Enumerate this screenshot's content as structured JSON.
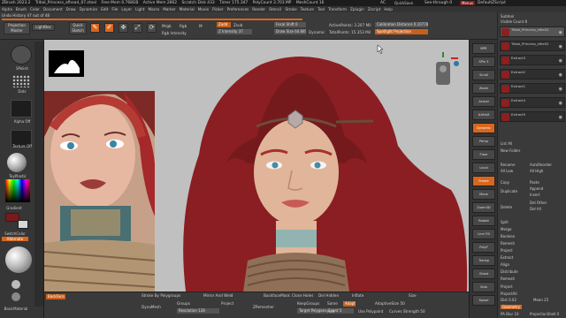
{
  "titlebar": {
    "app": "ZBrush 2023.2",
    "file": "Tribal_Princess_afhead_07.ztool",
    "free_mem": "Free Mem 0.768GB",
    "active_mem": "Active Mem 2862",
    "scratch": "Scratch Disk 433",
    "timer": "Timer 175.347",
    "polycount": "PolyCount 3.703 MP",
    "meshcount": "MeshCount 16",
    "ac": "AC",
    "quicksave": "QuickSave",
    "seethrough": "See-through 0",
    "menus": "Menus",
    "defaultzscript": "DefaultZScript"
  },
  "menubar": [
    "Alpha",
    "Brush",
    "Color",
    "Document",
    "Draw",
    "Dynamics",
    "Edit",
    "File",
    "Layer",
    "Light",
    "Macro",
    "Marker",
    "Material",
    "Movie",
    "Picker",
    "Preferences",
    "Render",
    "Stencil",
    "Stroke",
    "Texture",
    "Tool",
    "Transform",
    "Zplugin",
    "Zscript",
    "Help"
  ],
  "toolbar": {
    "history": "Undo History 47 out of 48",
    "projection_master": "Projection Master",
    "lightbox": "LightBox",
    "quick_sketch": "Quick Sketch",
    "edit": "Edit",
    "draw": "Draw",
    "move": "Move",
    "scale": "Scale",
    "rotate": "Rotate",
    "mrgb": "Mrgb",
    "rgb": "Rgb",
    "m": "M",
    "rgb_intensity": "Rgb Intensity",
    "zadd": "Zadd",
    "zsub": "Zsub",
    "z_intensity": "Z Intensity 37",
    "focal_shift": "Focal Shift 0",
    "draw_size": "Draw Size 64.68128",
    "dynamic": "Dynamic",
    "active_points": "ActivePoints: 3.207 Mil",
    "total_points": "TotalPoints: 15.353 Mil",
    "calibration": "Calibration Distance 0.10778",
    "spotlight": "Spotlight Projection"
  },
  "leftpanel": {
    "brush": "SPolish",
    "stroke": "Dots",
    "alpha": "Alpha Off",
    "texture": "Texture Off",
    "material": "ToyPlastic",
    "gradient": "Gradient",
    "switch_color": "SwitchColor",
    "alternate": "Alternate",
    "basic_material": "BasicMaterial"
  },
  "bottombar": {
    "backface": "BackFace",
    "polygroups": "Stroke By Polygroups",
    "mirror_weld": "Mirror And Weld",
    "backface_mask": "BackfaceMask",
    "close_holes": "Close Holes",
    "del_hidden": "Del Hidden",
    "inflate": "Inflate",
    "size": "Size",
    "groups": "Groups",
    "dynamesh": "DynaMesh",
    "project": "Project",
    "resolution": "Resolution 128",
    "zremesher": "ZRemesher",
    "target_polycount": "Target Polygons Count 5",
    "keep_groups": "KeepGroups",
    "use_polypaint": "Use Polypaint",
    "adaptive_size": "AdaptiveSize 50",
    "curves_strength": "Curves Strength 50",
    "same": "Same",
    "half": "Half",
    "adapt": "Adapt"
  },
  "subtool": {
    "header": "Subtool",
    "visible_count": "Visible Count 8",
    "items": [
      {
        "name": "Tribal_Princess_sfhe02",
        "selected": true
      },
      {
        "name": "Tribal_Princess_sfhe02"
      },
      {
        "name": "Extract3"
      },
      {
        "name": "Extract2"
      },
      {
        "name": "Extract1"
      },
      {
        "name": "Extract4"
      },
      {
        "name": "Extract5"
      }
    ],
    "list_all": "List All",
    "new_folder": "New Folder",
    "rename": "Rename",
    "autoreorder": "AutoReorder",
    "all_low": "All Low",
    "all_high": "All High",
    "copy": "Copy",
    "paste": "Paste",
    "duplicate": "Duplicate",
    "append": "Append",
    "insert": "Insert",
    "delete": "Delete",
    "del_other": "Del Other",
    "del_all": "Del All",
    "split": "Split",
    "merge": "Merge",
    "boolean": "Boolean",
    "remesh": "Remesh",
    "project": "Project",
    "extract": "Extract",
    "align": "Align",
    "distribute": "Distribute",
    "project_all": "ProjectAll",
    "dist": "Dist 0.02",
    "mean": "Mean 25",
    "geometry": "Geometry",
    "pa_blur": "PA Blur 10",
    "project_shell": "ProjectionShell 0"
  },
  "dock": [
    "BPR",
    "SPix 3",
    "Scroll",
    "Zoom",
    "Actual",
    "AAHalf",
    "Dynamic",
    "Persp",
    "Floor",
    "Local",
    "Frame",
    "Move",
    "Zoom3D",
    "Rotate",
    "Line Fill",
    "PolyF",
    "Transp",
    "Ghost",
    "Solo",
    "Xpose"
  ],
  "colors": {
    "accent": "#d9661e",
    "hair": "#8b1e22",
    "skin": "#e0b59a",
    "bg": "#c0c0c0"
  }
}
